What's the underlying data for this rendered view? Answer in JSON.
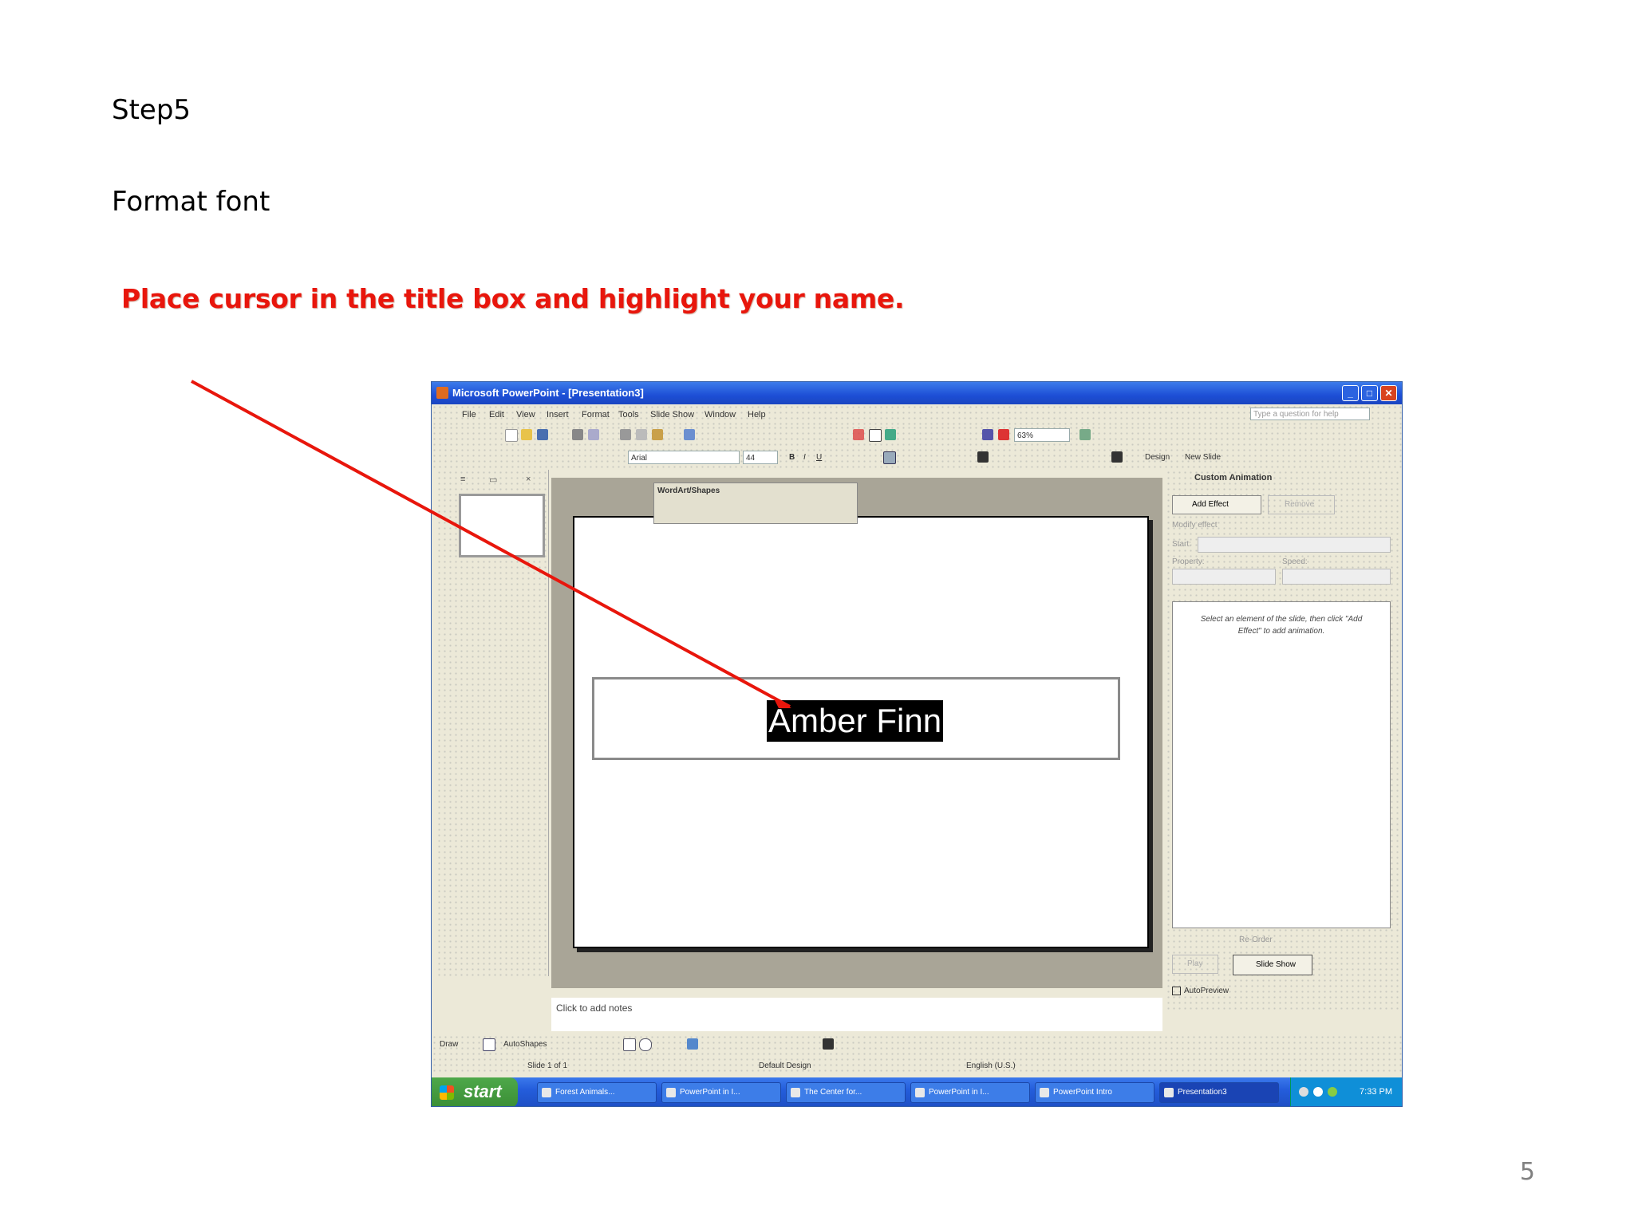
{
  "slide": {
    "step": "Step5",
    "subtitle": "Format font",
    "instruction": "Place cursor in the title box and highlight your name.",
    "page_number": "5"
  },
  "window": {
    "title": "Microsoft PowerPoint - [Presentation3]",
    "min": "_",
    "max": "□",
    "close": "✕"
  },
  "menu": {
    "items": [
      "File",
      "Edit",
      "View",
      "Insert",
      "Format",
      "Tools",
      "Slide Show",
      "Window",
      "Help"
    ],
    "ask_placeholder": "Type a question for help"
  },
  "toolbar": {
    "zoom": "63%",
    "font": "Arial",
    "size": "44",
    "design": "Design",
    "new_slide": "New Slide"
  },
  "wordart_toolbar": {
    "title": "WordArt/Shapes"
  },
  "slide_content": {
    "name": "Amber Finn"
  },
  "notes": {
    "placeholder": "Click to add notes"
  },
  "task_pane": {
    "title": "Custom Animation",
    "add_effect": "Add Effect",
    "remove": "Remove",
    "modify_label": "Modify effect",
    "start_label": "Start:",
    "property_label": "Property:",
    "speed_label": "Speed:",
    "hint": "Select an element of the slide, then click \"Add Effect\" to add animation.",
    "reorder": "Re-Order",
    "play": "Play",
    "slide_show": "Slide Show",
    "autopreview": "AutoPreview"
  },
  "drawing": {
    "draw": "Draw",
    "autoshapes": "AutoShapes"
  },
  "status": {
    "slide": "Slide 1 of 1",
    "design": "Default Design",
    "language": "English (U.S.)"
  },
  "taskbar": {
    "start": "start",
    "tasks": [
      "Forest Animals...",
      "PowerPoint in I...",
      "The Center for...",
      "PowerPoint in I...",
      "PowerPoint Intro",
      "Presentation3"
    ],
    "clock": "7:33 PM"
  },
  "colors": {
    "instruction": "#e8160c",
    "arrow": "#e8160c",
    "titlebar": "#1d4fd6",
    "start": "#3a8e35"
  }
}
